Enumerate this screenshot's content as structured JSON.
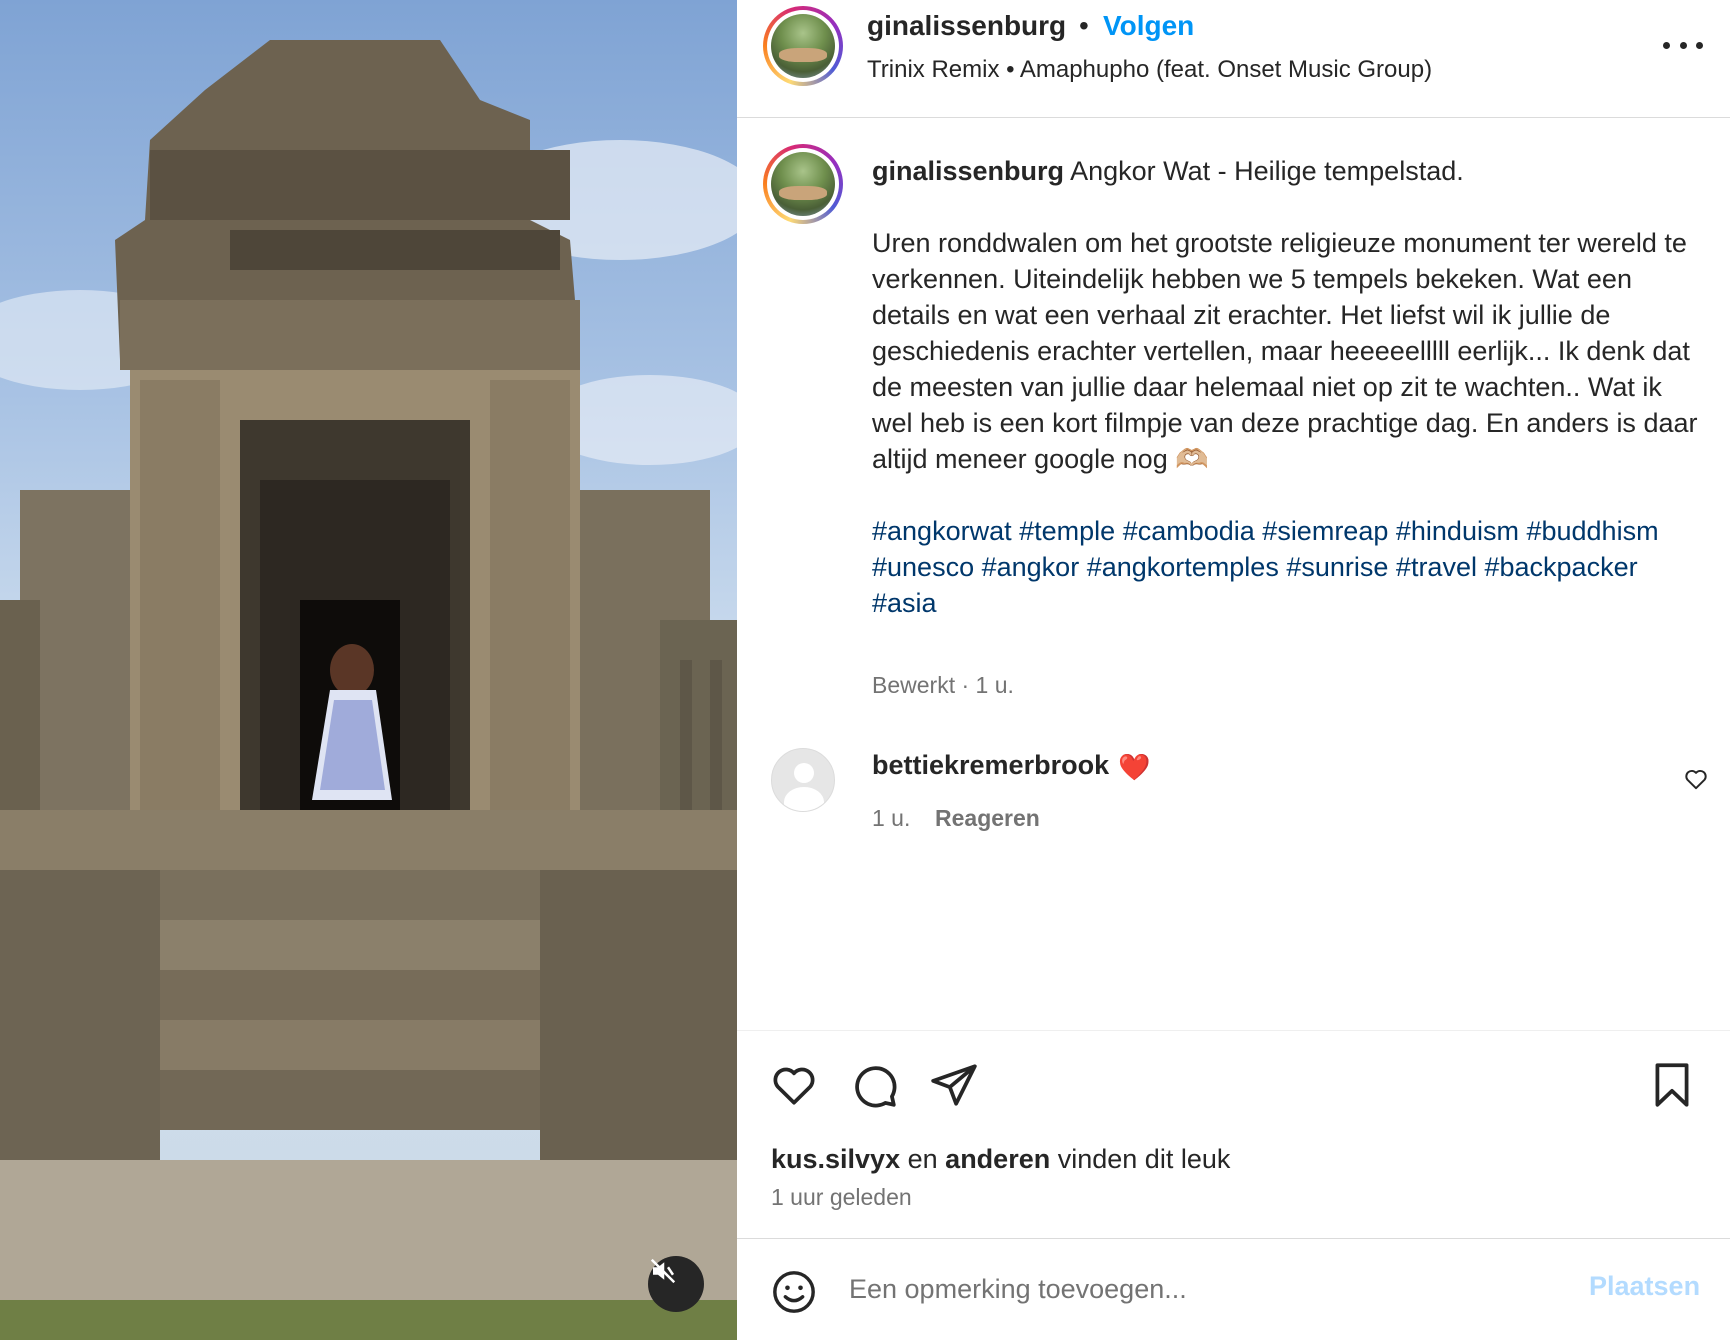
{
  "post": {
    "username": "ginalissenburg",
    "separator": "•",
    "follow_label": "Volgen",
    "music": "Trinix Remix • Amaphupho (feat. Onset Music Group)",
    "caption_title": "Angkor Wat - Heilige tempelstad.",
    "caption_body": "Uren ronddwalen om het grootste religieuze monument ter wereld te verkennen. Uiteindelijk hebben we 5 tempels bekeken. Wat een details en wat een verhaal zit erachter. Het liefst wil ik jullie de geschiedenis erachter vertellen, maar heeeeelllll eerlijk... Ik denk dat de meesten van jullie daar helemaal niet op zit te wachten.. Wat ik wel heb is een kort filmpje van deze prachtige dag. En anders is daar altijd meneer google nog 🫶🏼",
    "hashtags": [
      "#angkorwat",
      "#temple",
      "#cambodia",
      "#siemreap",
      "#hinduism",
      "#buddhism",
      "#unesco",
      "#angkor",
      "#angkortemples",
      "#sunrise",
      "#travel",
      "#backpacker",
      "#asia"
    ],
    "edited_meta": "Bewerkt · 1 u."
  },
  "comment": {
    "username": "bettiekremerbrook",
    "text": "❤️",
    "time": "1 u.",
    "reply_label": "Reageren"
  },
  "likes": {
    "first_user": "kus.silvyx",
    "and_label": "en",
    "others_label": "anderen",
    "suffix": "vinden dit leuk",
    "time_ago": "1 uur geleden"
  },
  "add_comment": {
    "placeholder": "Een opmerking toevoegen...",
    "post_label": "Plaatsen"
  },
  "icons": {
    "more": "more-options-icon",
    "mute": "muted-speaker-icon",
    "like": "heart-icon",
    "comment": "comment-bubble-icon",
    "share": "paper-plane-icon",
    "save": "bookmark-icon",
    "emoji": "smiley-icon"
  },
  "colors": {
    "accent": "#0095f6",
    "hashtag": "#00376b",
    "muted_text": "#737373",
    "post_button_disabled": "#b3dbff",
    "heart": "#e0245e"
  }
}
